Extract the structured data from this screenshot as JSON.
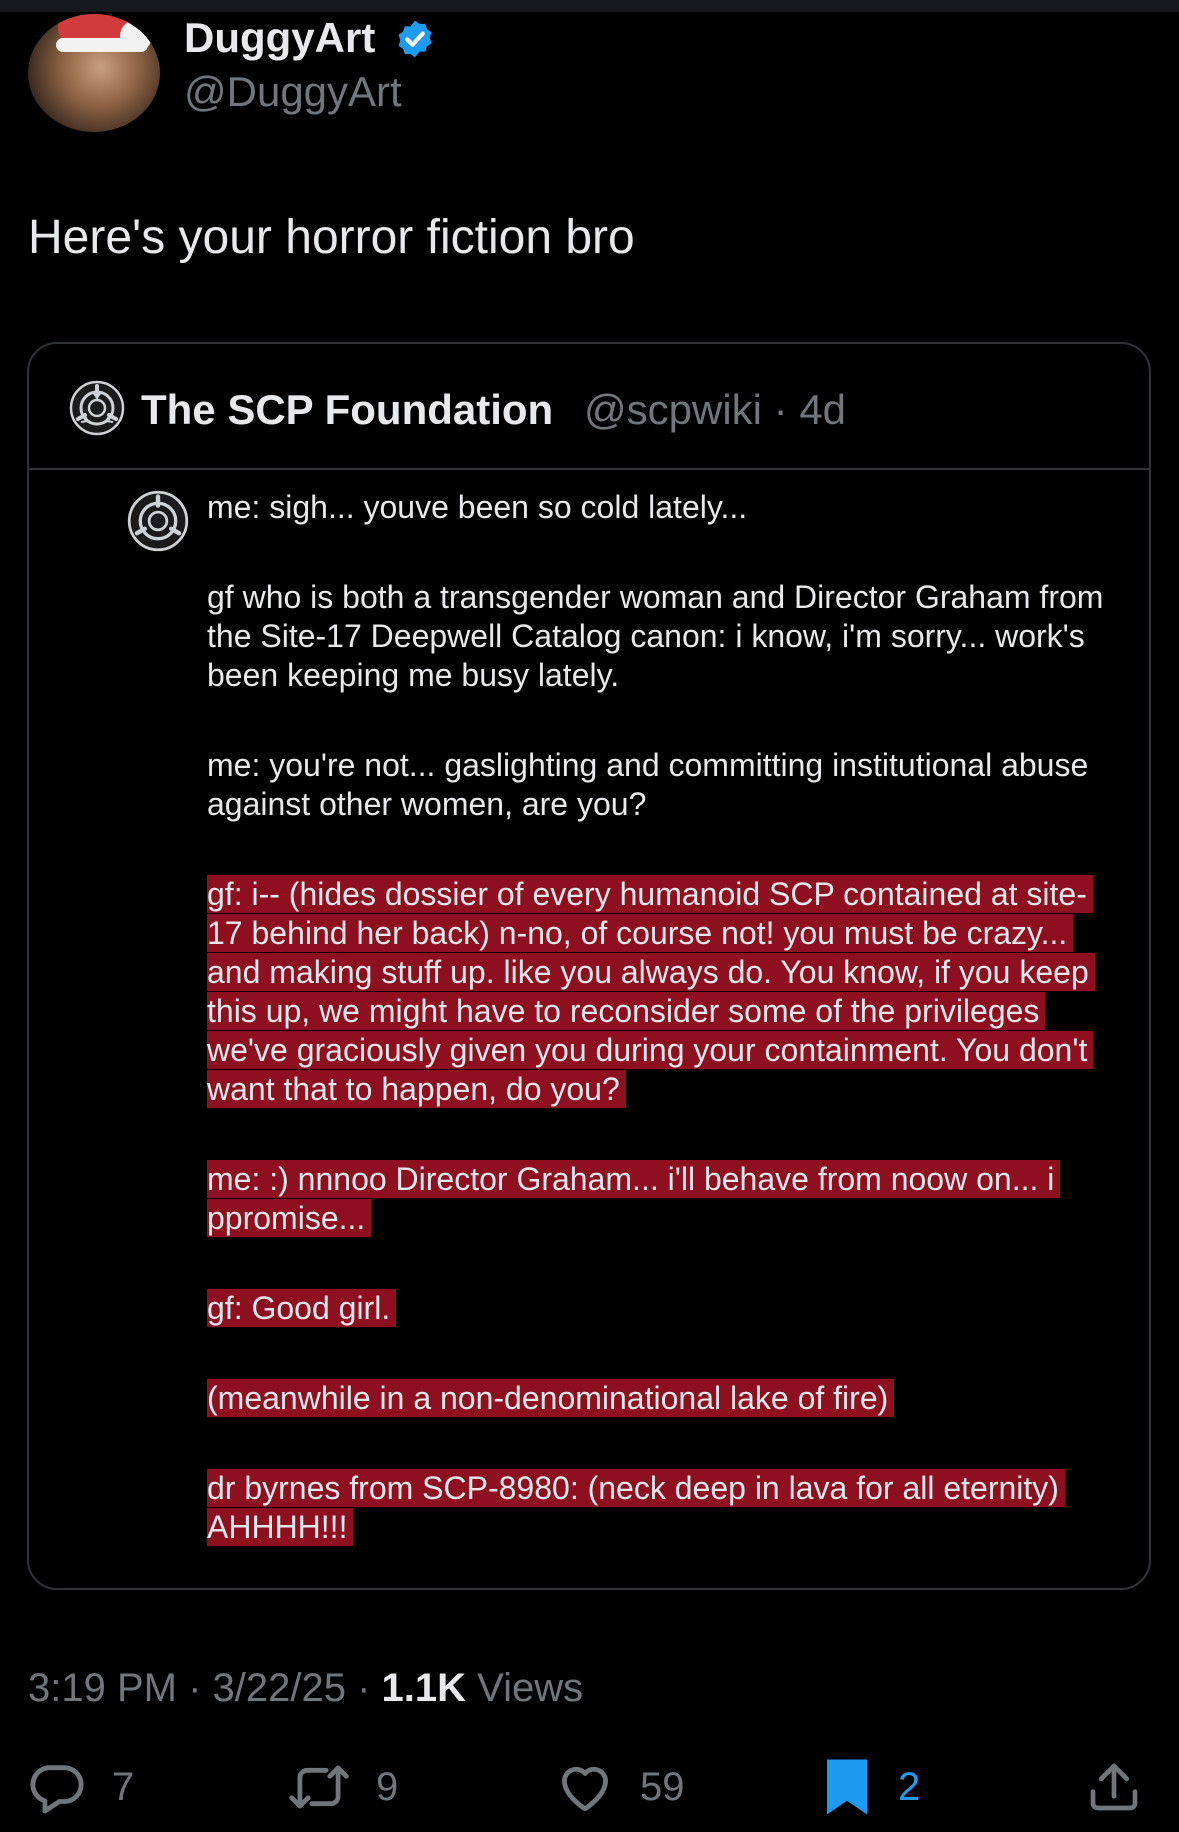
{
  "author": {
    "name": "DuggyArt",
    "handle": "@DuggyArt"
  },
  "tweet": {
    "text": "Here's your horror fiction bro"
  },
  "quoted": {
    "name": "The SCP Foundation",
    "handle": "@scpwiki",
    "age": "4d",
    "paragraphs": [
      "me: sigh... youve been so cold lately...",
      "gf who is both a transgender woman and Director Graham from the Site-17 Deepwell Catalog canon: i know, i'm sorry... work's been keeping me busy lately.",
      "me: you're not... gaslighting and committing institutional abuse against other women, are you?",
      "gf: i-- (hides dossier of every humanoid SCP contained at site-17 behind her back) n-no, of course not! you must be crazy... and making stuff up. like you always do. You know, if you keep this up, we might have to reconsider some of the privileges we've graciously given you during your containment. You don't want that to happen, do you?",
      "me: :)  nnnoo Director Graham... i'll behave from noow on... i ppromise...",
      "gf: Good girl.",
      "(meanwhile in a non-denominational lake of fire)",
      "dr byrnes from SCP-8980: (neck deep in lava for all eternity) AHHHH!!!"
    ]
  },
  "meta": {
    "time": "3:19 PM",
    "date": "3/22/25",
    "views_count": "1.1K",
    "views_label": "Views"
  },
  "actions": {
    "replies": "7",
    "reposts": "9",
    "likes": "59",
    "bookmarks": "2"
  },
  "icons": [
    "verified-badge-icon",
    "scp-logo-icon",
    "reply-icon",
    "repost-icon",
    "like-icon",
    "bookmark-icon",
    "share-icon"
  ],
  "colors": {
    "accent": "#1d9bf0",
    "highlight": "#8e1020",
    "muted": "#71767b"
  }
}
